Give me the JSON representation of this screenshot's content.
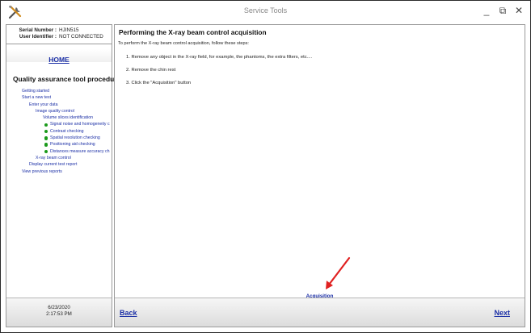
{
  "window": {
    "title": "Service Tools",
    "controls": [
      "_",
      "⧉",
      "✕"
    ]
  },
  "sidebar": {
    "serial_label": "Serial Number :",
    "serial_value": "HJIN515",
    "user_label": "User Identifier :",
    "user_value": "NOT CONNECTED",
    "home": "HOME",
    "section_title": "Quality assurance tool procedure",
    "nav": [
      {
        "label": "Getting started",
        "level": 0,
        "dot": false
      },
      {
        "label": "Start a new test",
        "level": 0,
        "dot": false
      },
      {
        "label": "Enter your data",
        "level": 1,
        "dot": false
      },
      {
        "label": "Image quality control",
        "level": 2,
        "dot": false
      },
      {
        "label": "Volume slices identification",
        "level": 3,
        "dot": false
      },
      {
        "label": "Signal noise and homogeneity c",
        "level": 4,
        "dot": true
      },
      {
        "label": "Contrast checking",
        "level": 4,
        "dot": true
      },
      {
        "label": "Spatial resolution checking",
        "level": 4,
        "dot": true
      },
      {
        "label": "Positioning aid checking",
        "level": 4,
        "dot": true
      },
      {
        "label": "Distances measure accuracy ch",
        "level": 4,
        "dot": true
      },
      {
        "label": "X-ray beam control",
        "level": 2,
        "dot": false
      },
      {
        "label": "Display current test report",
        "level": 1,
        "dot": false
      },
      {
        "label": "View previous reports",
        "level": 0,
        "dot": false
      }
    ],
    "date": "6/23/2020",
    "time": "2:17:53 PM"
  },
  "main": {
    "title": "Performing the X-ray beam control acquisition",
    "intro": "To perform the X-ray beam control acquisition, follow these steps:",
    "steps": [
      "1. Remove any object in the X-ray field, for example, the phantoms, the extra filters,  etc....",
      "2. Remove the chin rest",
      "3. Click the \"Acquisition\" button"
    ],
    "acquisition_link": "Acquisition",
    "annotation_color": "#e02020"
  },
  "footer": {
    "back": "Back",
    "next": "Next"
  },
  "colors": {
    "link": "#1b2fa6",
    "status_dot": "#1a9a1a"
  }
}
